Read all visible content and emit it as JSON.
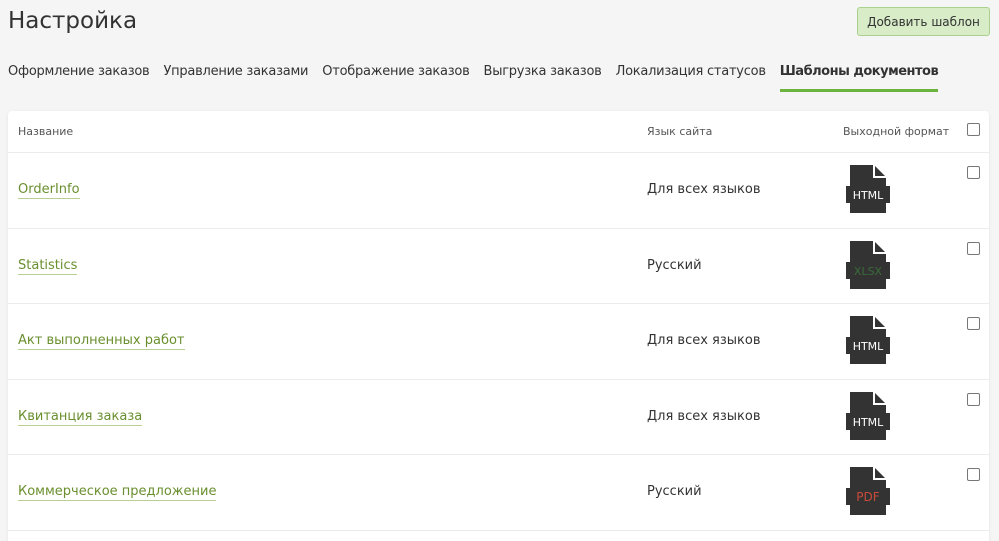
{
  "page": {
    "title": "Настройка",
    "add_button_label": "Добавить шаблон"
  },
  "tabs": [
    {
      "label": "Оформление заказов",
      "active": false
    },
    {
      "label": "Управление заказами",
      "active": false
    },
    {
      "label": "Отображение заказов",
      "active": false
    },
    {
      "label": "Выгрузка заказов",
      "active": false
    },
    {
      "label": "Локализация статусов",
      "active": false
    },
    {
      "label": "Шаблоны документов",
      "active": true
    }
  ],
  "table": {
    "columns": {
      "name": "Название",
      "language": "Язык сайта",
      "format": "Выходной формат"
    },
    "rows": [
      {
        "name": "OrderInfo",
        "language": "Для всех языков",
        "format": "HTML",
        "format_color": "#ffffff"
      },
      {
        "name": "Statistics",
        "language": "Русский",
        "format": "XLSX",
        "format_color": "#3a6b3a"
      },
      {
        "name": "Акт выполненных работ",
        "language": "Для всех языков",
        "format": "HTML",
        "format_color": "#ffffff"
      },
      {
        "name": "Квитанция заказа",
        "language": "Для всех языков",
        "format": "HTML",
        "format_color": "#ffffff"
      },
      {
        "name": "Коммерческое предложение",
        "language": "Русский",
        "format": "PDF",
        "format_color": "#c94a3a"
      }
    ]
  },
  "colors": {
    "accent_green": "#6cb33f",
    "link_green": "#6a8f2f",
    "button_bg": "#d7ecc7",
    "icon_dark": "#333333"
  }
}
